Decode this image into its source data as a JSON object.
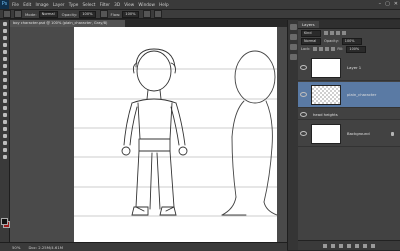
{
  "menubar": {
    "logo": "Ps",
    "items": [
      "File",
      "Edit",
      "Image",
      "Layer",
      "Type",
      "Select",
      "Filter",
      "3D",
      "View",
      "Window",
      "Help"
    ],
    "controls": [
      "–",
      "▢",
      "✕"
    ]
  },
  "options": {
    "mode_label": "Mode:",
    "mode_value": "Normal",
    "opacity_label": "Opacity:",
    "opacity_value": "100%",
    "flow_label": "Flow:",
    "flow_value": "100%"
  },
  "document": {
    "tab_title": "boy character.psd @ 100% (plain_character, Gray/8)"
  },
  "status": {
    "zoom": "50%",
    "doc_size": "Doc: 2.25M/4.61M"
  },
  "colors": {
    "foreground": "#111111",
    "background": "#9a1b1b",
    "selected_layer": "#5a7aa4"
  },
  "layers_panel": {
    "tab": "Layers",
    "kind_label": "Kind",
    "blend_mode": "Normal",
    "opacity_label": "Opacity:",
    "opacity_value": "100%",
    "lock_label": "Lock:",
    "fill_label": "Fill:",
    "fill_value": "100%",
    "layers": [
      {
        "name": "Layer 1",
        "selected": false,
        "thumb": "white"
      },
      {
        "name": "plain_character",
        "selected": true,
        "thumb": "checker"
      },
      {
        "name": "head heights",
        "selected": false,
        "thumb": "none"
      },
      {
        "name": "Background",
        "selected": false,
        "thumb": "white"
      }
    ]
  }
}
